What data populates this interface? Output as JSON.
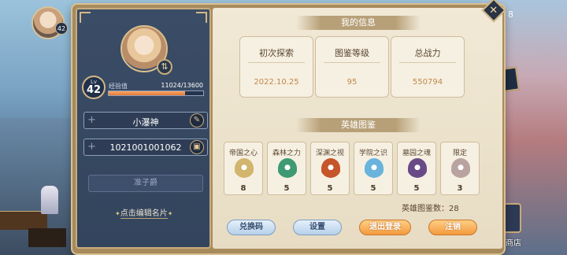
{
  "background": {
    "player_level": "42",
    "currency_count": "8",
    "shop_label": "商店"
  },
  "profile": {
    "level_prefix": "Lv",
    "level": "42",
    "exp_label": "经验值",
    "exp_current": 11024,
    "exp_max": 13600,
    "exp_text": "11024/13600",
    "exp_fraction": 0.81,
    "nickname": "小瀑神",
    "player_id": "1021001001062",
    "title": "准子爵",
    "edit_card_label": "点击编辑名片"
  },
  "info": {
    "section_title": "我的信息",
    "stats": [
      {
        "label": "初次探索",
        "value": "2022.10.25"
      },
      {
        "label": "图鉴等级",
        "value": "95"
      },
      {
        "label": "总战力",
        "value": "550794"
      }
    ]
  },
  "codex": {
    "section_title": "英雄图鉴",
    "factions": [
      {
        "name": "帝国之心",
        "count": "8",
        "color": "#d2b56e"
      },
      {
        "name": "森林之力",
        "count": "5",
        "color": "#3f9a74"
      },
      {
        "name": "深渊之视",
        "count": "5",
        "color": "#c6552b"
      },
      {
        "name": "学院之识",
        "count": "5",
        "color": "#6ab3dc"
      },
      {
        "name": "墓园之魂",
        "count": "5",
        "color": "#6a4a86"
      },
      {
        "name": "限定",
        "count": "3",
        "color": "#b9a3a0"
      }
    ],
    "total_label": "英雄图鉴数：28"
  },
  "buttons": {
    "redeem": "兑换码",
    "settings": "设置",
    "logout": "退出登录",
    "cancel_account": "注销"
  }
}
